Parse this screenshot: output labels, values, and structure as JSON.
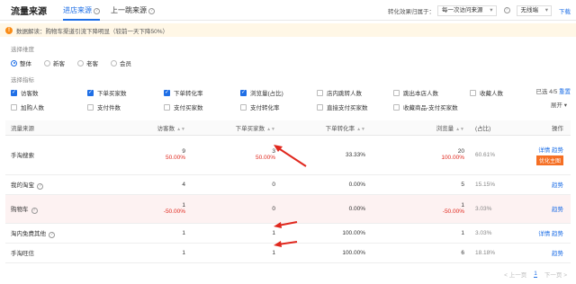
{
  "header": {
    "title": "流量来源",
    "tabs": [
      {
        "label": "进店来源"
      },
      {
        "label": "上一跳来源"
      }
    ],
    "conversion_label": "转化效果归属于：",
    "conversion_value": "每一次访问来源",
    "terminal_value": "无线端",
    "download_label": "下载"
  },
  "alert": {
    "text": "数据解读：购物车渠道引流下降明显（较前一天下降50%）"
  },
  "dimension": {
    "label": "选择维度",
    "options": [
      "整体",
      "新客",
      "老客",
      "会员"
    ],
    "selected": 0
  },
  "metrics": {
    "label": "选择指标",
    "count": "已选 4/5",
    "reset": "重置",
    "expand": "展开",
    "items": [
      {
        "label": "访客数",
        "checked": true
      },
      {
        "label": "下单买家数",
        "checked": true
      },
      {
        "label": "下单转化率",
        "checked": true
      },
      {
        "label": "浏览量(占比)",
        "checked": true
      },
      {
        "label": "店内跳转人数",
        "checked": false
      },
      {
        "label": "跳出本店人数",
        "checked": false
      },
      {
        "label": "收藏人数",
        "checked": false
      },
      {
        "label": "加购人数",
        "checked": false
      },
      {
        "label": "支付件数",
        "checked": false
      },
      {
        "label": "支付买家数",
        "checked": false
      },
      {
        "label": "支付转化率",
        "checked": false
      },
      {
        "label": "直接支付买家数",
        "checked": false
      },
      {
        "label": "收藏商品-支付买家数",
        "checked": false
      }
    ]
  },
  "table": {
    "headers": {
      "source": "流量来源",
      "visitors": "访客数",
      "buyers": "下单买家数",
      "conversion": "下单转化率",
      "pageviews": "浏览量",
      "share": "(占比)",
      "ops": "操作"
    },
    "rows": [
      {
        "name": "手淘搜索",
        "visitors": "9",
        "visitors_chg": "50.00%",
        "buyers": "3",
        "buyers_chg": "50.00%",
        "conversion": "33.33%",
        "pv": "20",
        "pv_chg": "100.00%",
        "share": "60.61%",
        "ops": [
          "详情",
          "趋势"
        ],
        "badge": "优化主图"
      },
      {
        "name": "我的淘宝",
        "visitors": "4",
        "buyers": "0",
        "conversion": "0.00%",
        "pv": "5",
        "share": "15.15%",
        "ops": [
          "趋势"
        ]
      },
      {
        "name": "购物车",
        "visitors": "1",
        "visitors_chg": "-50.00%",
        "buyers": "0",
        "conversion": "0.00%",
        "pv": "1",
        "pv_chg": "-50.00%",
        "share": "3.03%",
        "ops": [
          "趋势"
        ]
      },
      {
        "name": "淘内免费其他",
        "visitors": "1",
        "buyers": "1",
        "conversion": "100.00%",
        "pv": "1",
        "share": "3.03%",
        "ops": [
          "详情",
          "趋势"
        ]
      },
      {
        "name": "手淘旺信",
        "visitors": "1",
        "buyers": "1",
        "conversion": "100.00%",
        "pv": "6",
        "share": "18.18%",
        "ops": [
          "趋势"
        ]
      }
    ]
  },
  "pager": {
    "prev": "< 上一页",
    "current": "1",
    "next": "下一页 >"
  },
  "colors": {
    "accent": "#1f6fe6",
    "negative": "#e0281e",
    "badge": "#f56f24",
    "highlight_row": "#fdf2f2"
  }
}
